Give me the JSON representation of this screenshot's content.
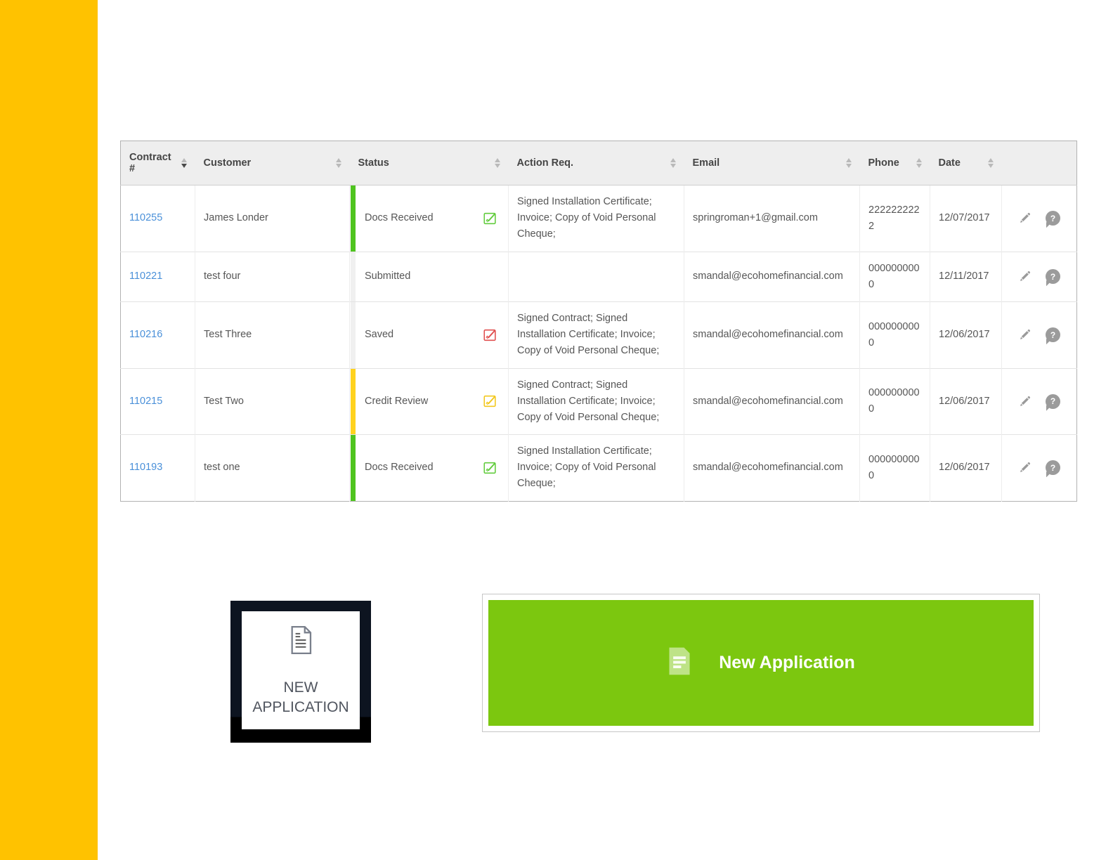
{
  "colors": {
    "sidebar_yellow": "#ffc200",
    "banner_green": "#7cc70f",
    "link_blue": "#4a90d9",
    "status_green": "#4fc41f",
    "status_yellow": "#ffd21e",
    "status_gray": "#f0f0f0",
    "icon_red": "#e04f4f"
  },
  "icons": {
    "help_glyph": "?"
  },
  "table": {
    "columns": [
      {
        "label": "Contract #",
        "sort": "desc"
      },
      {
        "label": "Customer",
        "sort": "none"
      },
      {
        "label": "Status",
        "sort": "none"
      },
      {
        "label": "Action Req.",
        "sort": "none"
      },
      {
        "label": "Email",
        "sort": "none"
      },
      {
        "label": "Phone",
        "sort": "none"
      },
      {
        "label": "Date",
        "sort": "none"
      },
      {
        "label": "",
        "sort": "hidden"
      }
    ],
    "rows": [
      {
        "contract": "110255",
        "customer": "James Londer",
        "status": "Docs Received",
        "bar": "green",
        "icon": "green",
        "action": "Signed Installation Certificate; Invoice; Copy of Void Personal Cheque;",
        "email": "springroman+1@gmail.com",
        "phone": "2222222222",
        "date": "12/07/2017"
      },
      {
        "contract": "110221",
        "customer": "test four",
        "status": "Submitted",
        "bar": "gray",
        "icon": "none",
        "action": "",
        "email": "smandal@ecohomefinancial.com",
        "phone": "0000000000",
        "date": "12/11/2017"
      },
      {
        "contract": "110216",
        "customer": "Test Three",
        "status": "Saved",
        "bar": "gray",
        "icon": "red",
        "action": "Signed Contract; Signed Installation Certificate; Invoice; Copy of Void Personal Cheque;",
        "email": "smandal@ecohomefinancial.com",
        "phone": "0000000000",
        "date": "12/06/2017"
      },
      {
        "contract": "110215",
        "customer": "Test Two",
        "status": "Credit Review",
        "bar": "yellow",
        "icon": "yellow",
        "action": "Signed Contract; Signed Installation Certificate; Invoice; Copy of Void Personal Cheque;",
        "email": "smandal@ecohomefinancial.com",
        "phone": "0000000000",
        "date": "12/06/2017"
      },
      {
        "contract": "110193",
        "customer": "test one",
        "status": "Docs Received",
        "bar": "green",
        "icon": "green",
        "action": "Signed Installation Certificate; Invoice; Copy of Void Personal Cheque;",
        "email": "smandal@ecohomefinancial.com",
        "phone": "0000000000",
        "date": "12/06/2017"
      }
    ]
  },
  "buttons": {
    "tile": {
      "label": "NEW APPLICATION"
    },
    "banner": {
      "label": "New Application"
    }
  }
}
